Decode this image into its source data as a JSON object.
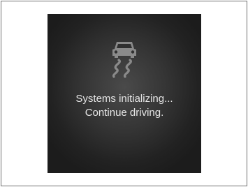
{
  "display": {
    "icon": "skid-car-icon",
    "message_line1": "Systems initializing...",
    "message_line2": "Continue driving.",
    "icon_color": "#8a8a8a",
    "text_color": "#e6e6e6"
  }
}
